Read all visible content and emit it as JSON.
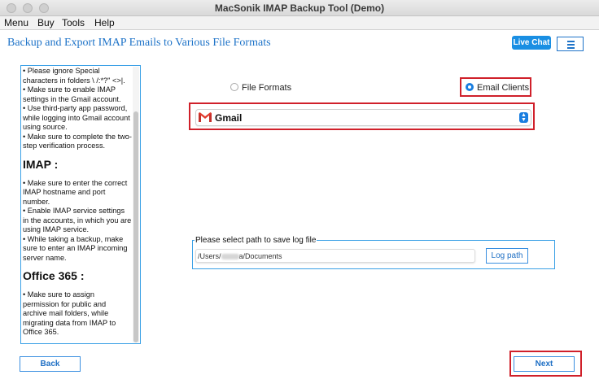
{
  "window": {
    "title": "MacSonik IMAP Backup Tool (Demo)"
  },
  "menu": [
    "Menu",
    "Buy",
    "Tools",
    "Help"
  ],
  "header": {
    "title": "Backup and Export IMAP Emails to Various File Formats",
    "live_chat": "Live Chat",
    "menu_icon": "hamburger-icon"
  },
  "info": {
    "gmail_items": [
      "• Please ignore Special characters in folders  \\ /:*?\" <>|.",
      "• Make sure to enable IMAP settings in the Gmail account.",
      "• Use third-party app password, while logging into Gmail account using source.",
      "• Make sure to complete the two-step verification process."
    ],
    "imap_heading": "IMAP :",
    "imap_items": [
      "• Make sure to enter the correct IMAP hostname and port number.",
      "• Enable IMAP service settings in the accounts, in which you are using IMAP service.",
      "• While taking a backup, make sure to enter an IMAP incoming server name."
    ],
    "office_heading": "Office 365 :",
    "office_items": [
      "• Make sure to assign permission for public and archive mail folders, while migrating data from IMAP to Office 365."
    ]
  },
  "options": {
    "file_formats": "File Formats",
    "email_clients": "Email Clients",
    "selected": "email_clients"
  },
  "dropdown": {
    "selected": "Gmail",
    "icon": "gmail-icon"
  },
  "log": {
    "title": "Please select path to save log file",
    "path_prefix": "/Users/",
    "path_suffix": "a/Documents",
    "button": "Log path"
  },
  "buttons": {
    "back": "Back",
    "next": "Next"
  },
  "colors": {
    "accent": "#1e73c8",
    "highlight": "#d0202a",
    "live_chat_bg": "#1a8fe3"
  }
}
